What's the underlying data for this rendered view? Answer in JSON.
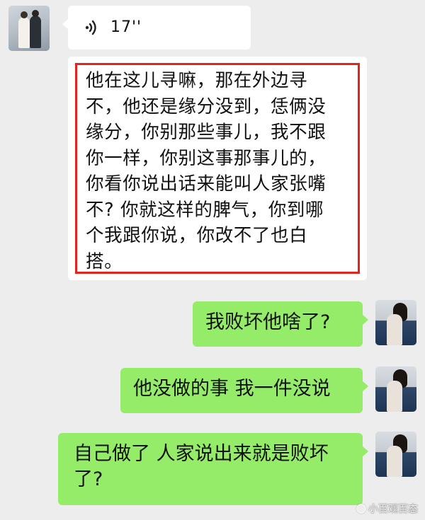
{
  "messages": {
    "voice": {
      "duration": "17''"
    },
    "highlighted_text": {
      "lines": [
        "他在这儿寻嘛，那在外边寻",
        "不，他还是缘分没到，恁俩没",
        "缘分，你别那些事儿，我不跟",
        "你一样，你别这事那事儿的，",
        "你看你说出话来能叫人家张嘴",
        "不? 你就这样的脾气，你到哪",
        "个我跟你说，你改不了也白",
        "搭。"
      ]
    },
    "reply_1": "我败坏他啥了?",
    "reply_2": "他没做的事 我一件没说",
    "reply_3": [
      "自己做了 人家说出来就是败坏",
      "了?"
    ]
  },
  "watermark": "小百观百态",
  "colors": {
    "sent_bubble": "#95ec69",
    "received_bubble": "#ffffff",
    "highlight_border": "#e2241f",
    "background": "#ededed"
  }
}
